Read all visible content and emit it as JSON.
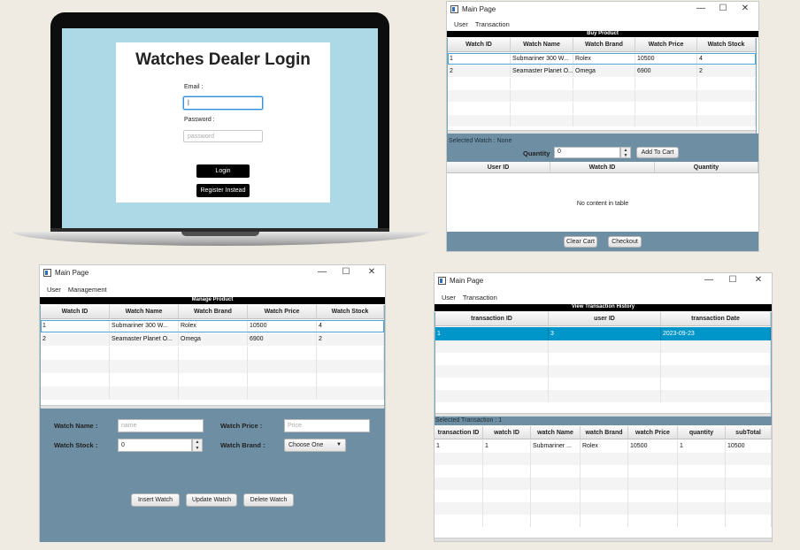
{
  "login": {
    "title": "Watches Dealer Login",
    "email_label": "Email :",
    "password_label": "Password :",
    "password_placeholder": "password",
    "login_button": "Login",
    "register_button": "Register Instead"
  },
  "buy_window": {
    "title": "Main Page",
    "menu": [
      "User",
      "Transaction"
    ],
    "section": "Buy Product",
    "columns": [
      "Watch ID",
      "Watch Name",
      "Watch Brand",
      "Watch Price",
      "Watch Stock"
    ],
    "rows": [
      [
        "1",
        "Submariner 300 W...",
        "Rolex",
        "10500",
        "4"
      ],
      [
        "2",
        "Seamaster Planet O...",
        "Omega",
        "6900",
        "2"
      ]
    ],
    "selected_watch": "Selected Watch : None",
    "quantity_label": "Quantity",
    "quantity_value": "0",
    "add_to_cart": "Add To Cart",
    "cart_columns": [
      "User ID",
      "Watch ID",
      "Quantity"
    ],
    "cart_empty": "No content in table",
    "clear_cart": "Clear Cart",
    "checkout": "Checkout"
  },
  "manage_window": {
    "title": "Main Page",
    "menu": [
      "User",
      "Management"
    ],
    "section": "Manage Product",
    "columns": [
      "Watch ID",
      "Watch Name",
      "Watch Brand",
      "Watch Price",
      "Watch Stock"
    ],
    "rows": [
      [
        "1",
        "Submariner 300 W...",
        "Rolex",
        "10500",
        "4"
      ],
      [
        "2",
        "Seamaster Planet O...",
        "Omega",
        "6900",
        "2"
      ]
    ],
    "name_label": "Watch Name :",
    "name_placeholder": "name",
    "price_label": "Watch Price :",
    "price_placeholder": "Price",
    "stock_label": "Watch Stock :",
    "stock_value": "0",
    "brand_label": "Watch Brand :",
    "brand_value": "Choose One",
    "insert": "Insert Watch",
    "update": "Update Watch",
    "delete": "Delete Watch"
  },
  "history_window": {
    "title": "Main Page",
    "menu": [
      "User",
      "Transaction"
    ],
    "section": "View Transaction History",
    "columns": [
      "transaction ID",
      "user ID",
      "transaction Date"
    ],
    "rows": [
      [
        "1",
        "3",
        "2023-09-23"
      ]
    ],
    "selected_transaction": "Selected Transaction : 1",
    "detail_columns": [
      "transaction ID",
      "watch ID",
      "watch Name",
      "watch Brand",
      "watch Price",
      "quantity",
      "subTotal"
    ],
    "detail_rows": [
      [
        "1",
        "1",
        "Submariner ...",
        "Rolex",
        "10500",
        "1",
        "10500"
      ]
    ]
  },
  "window_controls": {
    "minimize": "—",
    "maximize": "☐",
    "close": "✕"
  },
  "colors": {
    "panel": "#6e8fa3",
    "login_bg": "#add8e6",
    "selection": "#0096c9"
  }
}
